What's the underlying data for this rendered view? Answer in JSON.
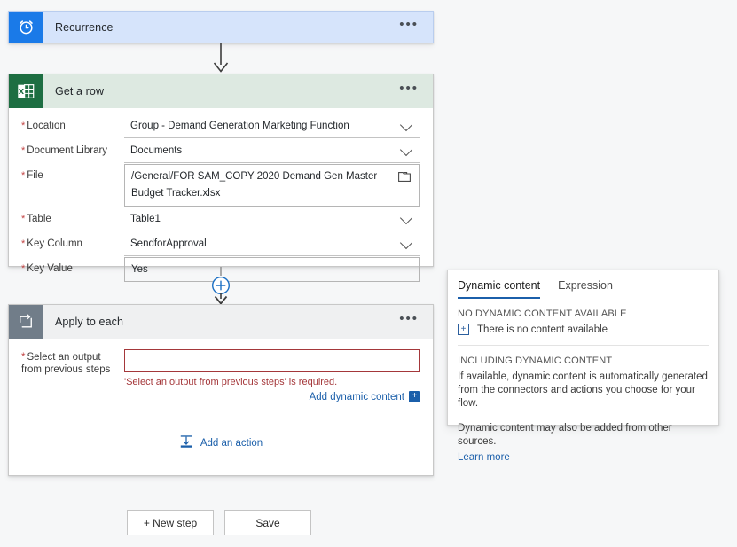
{
  "flow": {
    "trigger": {
      "title": "Recurrence",
      "icon": "clock-icon",
      "overflow": "•••",
      "header_color": "#d6e4fb",
      "icon_color": "#1a7ae8"
    },
    "get_a_row": {
      "title": "Get a row",
      "icon": "excel-icon",
      "overflow": "•••",
      "header_color": "#dde9e1",
      "icon_color": "#1d6e42",
      "fields": [
        {
          "label": "Location",
          "required": true,
          "value": "Group - Demand Generation Marketing Function",
          "control": "dropdown"
        },
        {
          "label": "Document Library",
          "required": true,
          "value": "Documents",
          "control": "dropdown"
        },
        {
          "label": "File",
          "required": true,
          "value": "/General/FOR SAM_COPY 2020 Demand Gen Master Budget Tracker.xlsx",
          "control": "file-picker"
        },
        {
          "label": "Table",
          "required": true,
          "value": "Table1",
          "control": "dropdown"
        },
        {
          "label": "Key Column",
          "required": true,
          "value": "SendforApproval",
          "control": "dropdown"
        },
        {
          "label": "Key Value",
          "required": true,
          "value": "Yes",
          "control": "text"
        }
      ]
    },
    "apply_to_each": {
      "title": "Apply to each",
      "icon": "loop-icon",
      "overflow": "•••",
      "header_color": "#eff0f1",
      "icon_color": "#717d89",
      "field_label_line1": "Select an output",
      "field_label_line2": "from previous steps",
      "field_value": "",
      "error_message": "'Select an output from previous steps' is required.",
      "error_color": "#a4373a",
      "add_dynamic_content_label": "Add dynamic content",
      "add_dynamic_content_badge": "+",
      "add_an_action_label": "Add an action"
    }
  },
  "dynamic_content_panel": {
    "tabs": [
      {
        "label": "Dynamic content",
        "active": true
      },
      {
        "label": "Expression",
        "active": false
      }
    ],
    "empty_heading": "NO DYNAMIC CONTENT AVAILABLE",
    "empty_icon": "+",
    "empty_text": "There is no content available",
    "including_heading": "INCLUDING DYNAMIC CONTENT",
    "including_body": "If available, dynamic content is automatically generated from the connectors and actions you choose for your flow.",
    "other_sources_text": "Dynamic content may also be added from other sources.",
    "learn_more_label": "Learn more",
    "accent_color": "#1b5faa"
  },
  "bottom_bar": {
    "new_step_label": "+ New step",
    "save_label": "Save"
  }
}
